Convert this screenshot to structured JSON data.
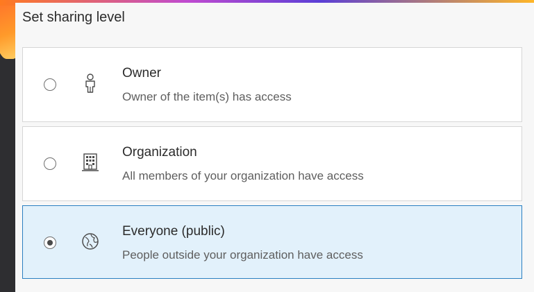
{
  "header": {
    "title": "Set sharing level"
  },
  "options": [
    {
      "label": "Owner",
      "description": "Owner of the item(s) has access",
      "selected": false,
      "icon": "user-icon"
    },
    {
      "label": "Organization",
      "description": "All members of your organization have access",
      "selected": false,
      "icon": "building-icon"
    },
    {
      "label": "Everyone (public)",
      "description": "People outside your organization have access",
      "selected": true,
      "icon": "globe-icon"
    }
  ],
  "colors": {
    "selected_bg": "#e2f1fb",
    "selected_border": "#2a7fc1",
    "panel_bg": "#f7f7f7"
  }
}
